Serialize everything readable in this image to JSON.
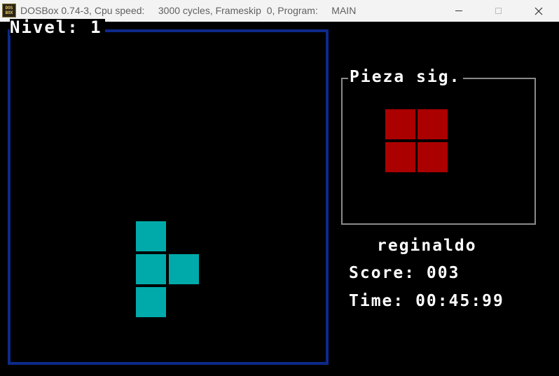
{
  "titlebar": {
    "icon_text_top": "DOS",
    "icon_text_bottom": "BOX",
    "title": "DOSBox 0.74-3, Cpu speed:     3000 cycles, Frameskip  0, Program:     MAIN"
  },
  "game": {
    "level_text": "Nivel: 1",
    "next_piece_label": "Pieza sig.",
    "player_name": "reginaldo",
    "score_text": "Score: 003",
    "time_text": "Time: 00:45:99",
    "colors": {
      "playfield_border": "#0d2a8a",
      "current_piece": "#00aaaa",
      "next_piece": "#aa0000",
      "next_box_border": "#8a8a8a"
    },
    "current_piece": {
      "shape": "T",
      "orientation": "pointing-right"
    },
    "next_piece": {
      "shape": "O"
    }
  }
}
